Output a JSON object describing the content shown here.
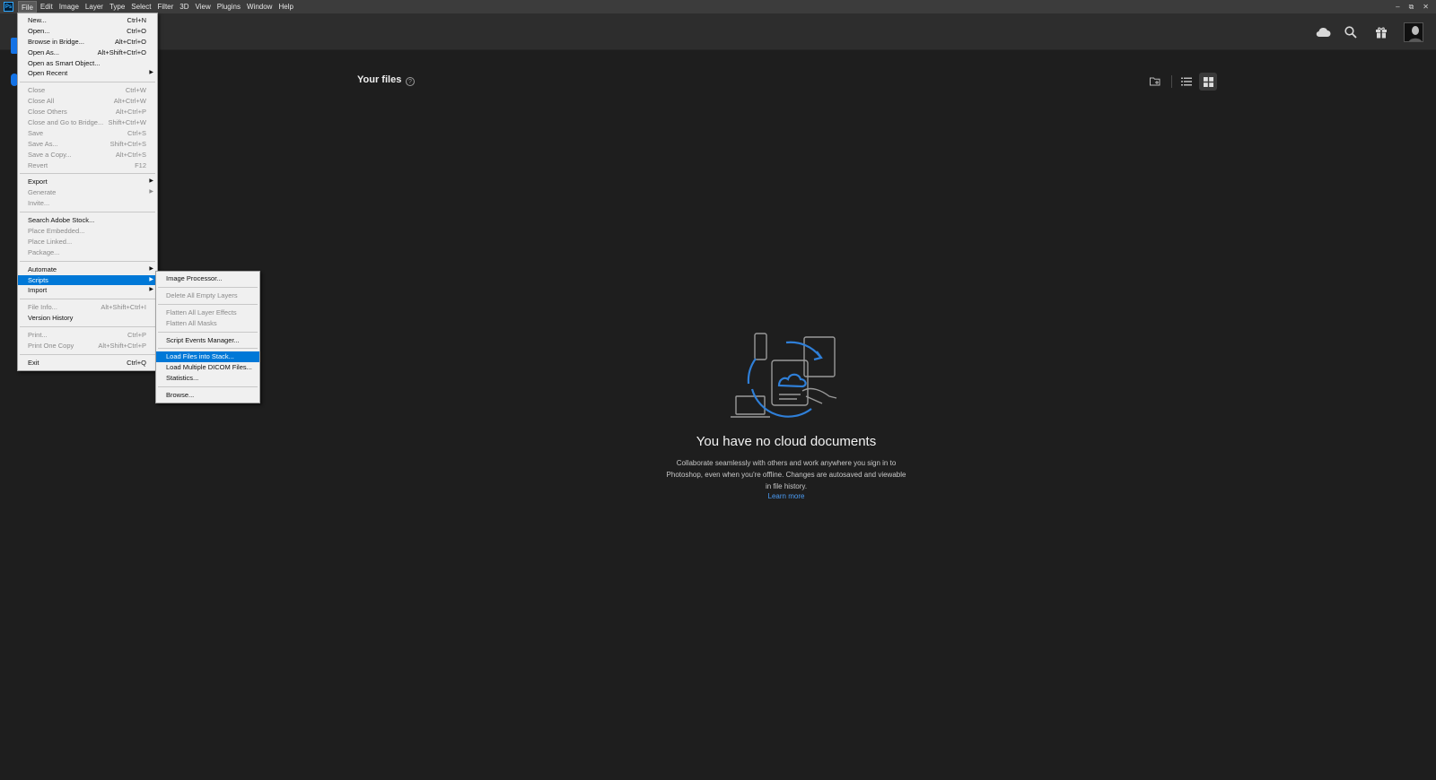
{
  "menubar": {
    "logo": "Ps",
    "items": [
      "File",
      "Edit",
      "Image",
      "Layer",
      "Type",
      "Select",
      "Filter",
      "3D",
      "View",
      "Plugins",
      "Window",
      "Help"
    ],
    "active": "File"
  },
  "window_controls": {
    "minimize": "–",
    "restore": "⧉",
    "close": "✕"
  },
  "header": {
    "icons": [
      "cloud-icon",
      "search-icon",
      "gift-icon",
      "avatar"
    ]
  },
  "main": {
    "title": "Your files",
    "help": "?",
    "view_buttons": [
      "new-folder-icon",
      "list-view-icon",
      "grid-view-icon"
    ],
    "empty_state": {
      "title": "You have no cloud documents",
      "description": "Collaborate seamlessly with others and work anywhere you sign in to Photoshop, even when you're offline. Changes are autosaved and viewable in file history.",
      "link": "Learn more"
    }
  },
  "file_menu": {
    "items": [
      {
        "label": "New...",
        "shortcut": "Ctrl+N",
        "enabled": true
      },
      {
        "label": "Open...",
        "shortcut": "Ctrl+O",
        "enabled": true
      },
      {
        "label": "Browse in Bridge...",
        "shortcut": "Alt+Ctrl+O",
        "enabled": true
      },
      {
        "label": "Open As...",
        "shortcut": "Alt+Shift+Ctrl+O",
        "enabled": true
      },
      {
        "label": "Open as Smart Object...",
        "shortcut": "",
        "enabled": true
      },
      {
        "label": "Open Recent",
        "shortcut": "",
        "enabled": true,
        "submenu": true
      },
      {
        "sep": true
      },
      {
        "label": "Close",
        "shortcut": "Ctrl+W",
        "enabled": false
      },
      {
        "label": "Close All",
        "shortcut": "Alt+Ctrl+W",
        "enabled": false
      },
      {
        "label": "Close Others",
        "shortcut": "Alt+Ctrl+P",
        "enabled": false
      },
      {
        "label": "Close and Go to Bridge...",
        "shortcut": "Shift+Ctrl+W",
        "enabled": false
      },
      {
        "label": "Save",
        "shortcut": "Ctrl+S",
        "enabled": false
      },
      {
        "label": "Save As...",
        "shortcut": "Shift+Ctrl+S",
        "enabled": false
      },
      {
        "label": "Save a Copy...",
        "shortcut": "Alt+Ctrl+S",
        "enabled": false
      },
      {
        "label": "Revert",
        "shortcut": "F12",
        "enabled": false
      },
      {
        "sep": true
      },
      {
        "label": "Export",
        "shortcut": "",
        "enabled": true,
        "submenu": true
      },
      {
        "label": "Generate",
        "shortcut": "",
        "enabled": false,
        "submenu": true
      },
      {
        "label": "Invite...",
        "shortcut": "",
        "enabled": false
      },
      {
        "sep": true
      },
      {
        "label": "Search Adobe Stock...",
        "shortcut": "",
        "enabled": true
      },
      {
        "label": "Place Embedded...",
        "shortcut": "",
        "enabled": false
      },
      {
        "label": "Place Linked...",
        "shortcut": "",
        "enabled": false
      },
      {
        "label": "Package...",
        "shortcut": "",
        "enabled": false
      },
      {
        "sep": true
      },
      {
        "label": "Automate",
        "shortcut": "",
        "enabled": true,
        "submenu": true
      },
      {
        "label": "Scripts",
        "shortcut": "",
        "enabled": true,
        "submenu": true,
        "highlighted": true
      },
      {
        "label": "Import",
        "shortcut": "",
        "enabled": true,
        "submenu": true
      },
      {
        "sep": true
      },
      {
        "label": "File Info...",
        "shortcut": "Alt+Shift+Ctrl+I",
        "enabled": false
      },
      {
        "label": "Version History",
        "shortcut": "",
        "enabled": true
      },
      {
        "sep": true
      },
      {
        "label": "Print...",
        "shortcut": "Ctrl+P",
        "enabled": false
      },
      {
        "label": "Print One Copy",
        "shortcut": "Alt+Shift+Ctrl+P",
        "enabled": false
      },
      {
        "sep": true
      },
      {
        "label": "Exit",
        "shortcut": "Ctrl+Q",
        "enabled": true
      }
    ]
  },
  "scripts_menu": {
    "items": [
      {
        "label": "Image Processor...",
        "enabled": true
      },
      {
        "sep": true
      },
      {
        "label": "Delete All Empty Layers",
        "enabled": false
      },
      {
        "sep": true
      },
      {
        "label": "Flatten All Layer Effects",
        "enabled": false
      },
      {
        "label": "Flatten All Masks",
        "enabled": false
      },
      {
        "sep": true
      },
      {
        "label": "Script Events Manager...",
        "enabled": true
      },
      {
        "sep": true
      },
      {
        "label": "Load Files into Stack...",
        "enabled": true,
        "highlighted": true
      },
      {
        "label": "Load Multiple DICOM Files...",
        "enabled": true
      },
      {
        "label": "Statistics...",
        "enabled": true
      },
      {
        "sep": true
      },
      {
        "label": "Browse...",
        "enabled": true
      }
    ]
  },
  "colors": {
    "accent": "#1473e6",
    "menu_highlight": "#0078d7",
    "link": "#4b9cf5",
    "background": "#1e1e1e"
  }
}
